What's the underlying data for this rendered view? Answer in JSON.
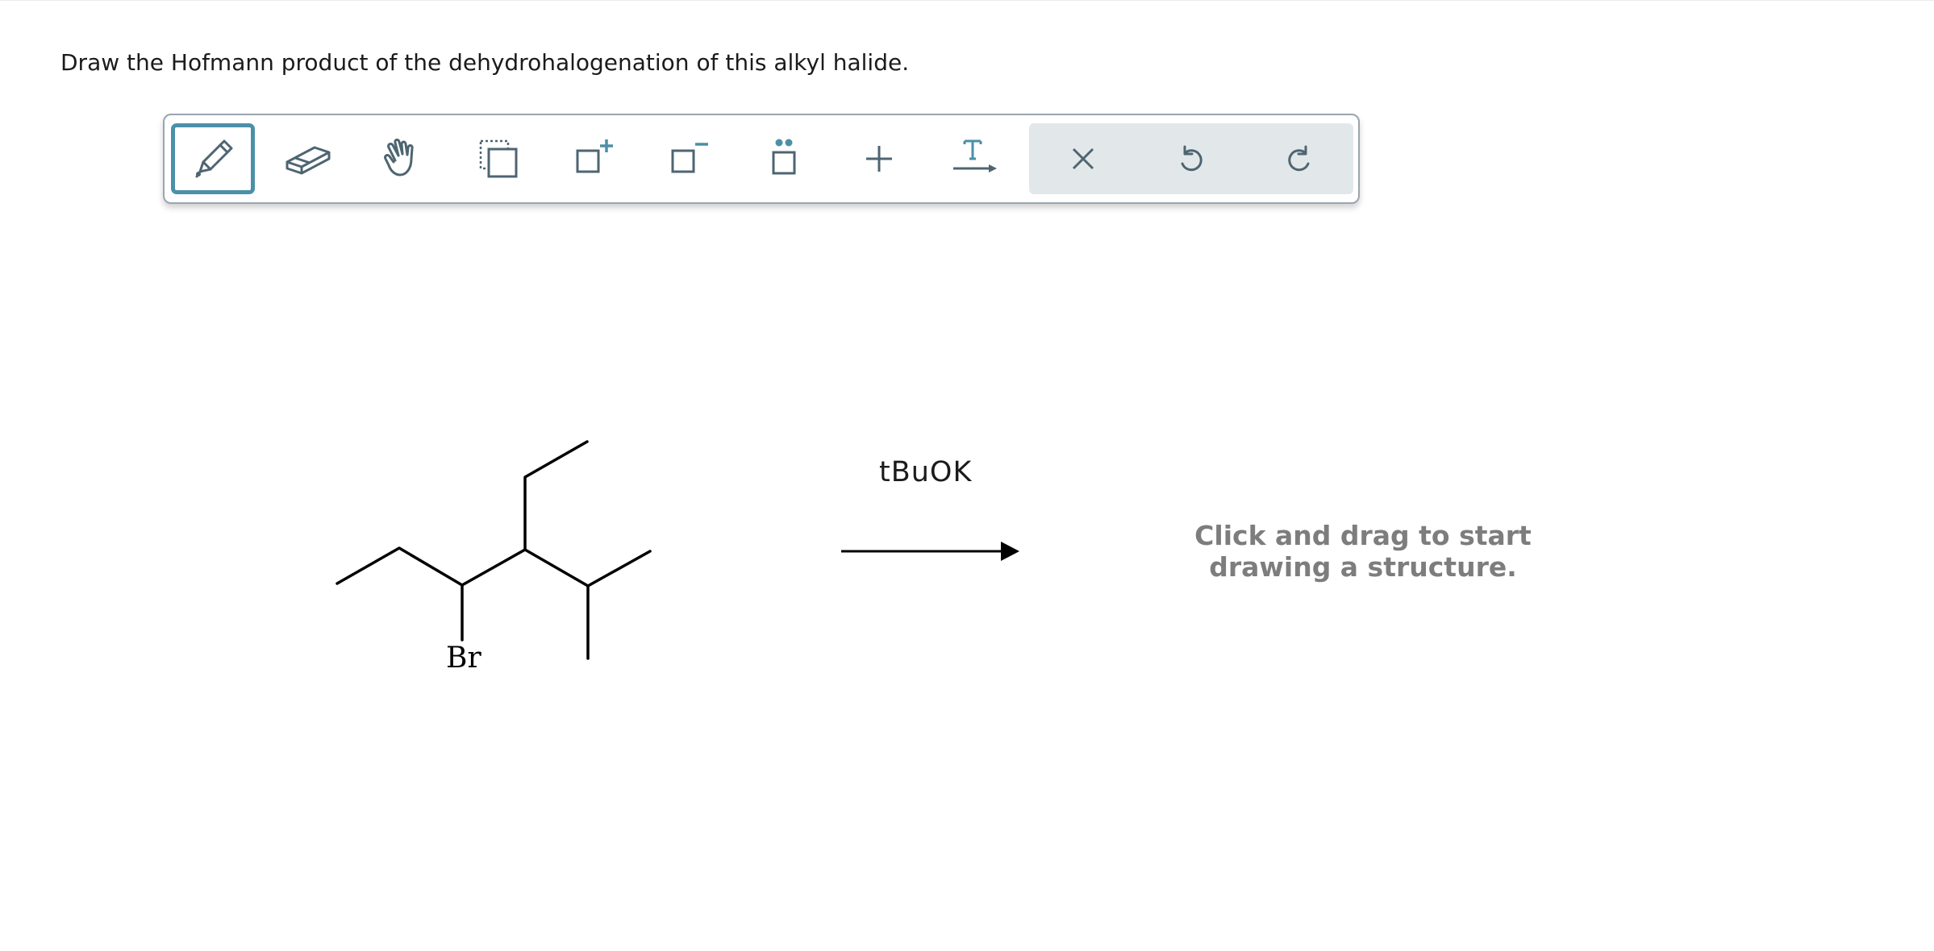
{
  "question": {
    "text": "Draw the Hofmann product of the dehydrohalogenation of this alkyl halide."
  },
  "toolbar": {
    "tools": [
      {
        "name": "draw-tool",
        "icon": "pencil-icon",
        "active": true
      },
      {
        "name": "erase-tool",
        "icon": "eraser-icon",
        "active": false
      },
      {
        "name": "move-tool",
        "icon": "hand-icon",
        "active": false
      },
      {
        "name": "select-tool",
        "icon": "selection-icon",
        "active": false
      },
      {
        "name": "increase-charge-tool",
        "icon": "positive-charge-icon",
        "active": false
      },
      {
        "name": "decrease-charge-tool",
        "icon": "negative-charge-icon",
        "active": false
      },
      {
        "name": "lone-pair-tool",
        "icon": "lone-pair-icon",
        "active": false
      },
      {
        "name": "add-reagent-tool",
        "icon": "plus-icon",
        "active": false
      },
      {
        "name": "reaction-text-tool",
        "icon": "text-arrow-icon",
        "active": false
      }
    ],
    "actions": [
      {
        "name": "clear-button",
        "icon": "close-icon"
      },
      {
        "name": "undo-button",
        "icon": "undo-icon"
      },
      {
        "name": "redo-button",
        "icon": "redo-icon"
      }
    ],
    "accent_color": "#4a90a8",
    "icon_color": "#4e6571"
  },
  "reaction": {
    "reagent": "tBuOK",
    "substituent_label": "Br"
  },
  "drawing_area": {
    "hint_line1": "Click and drag to start",
    "hint_line2": "drawing a structure."
  }
}
